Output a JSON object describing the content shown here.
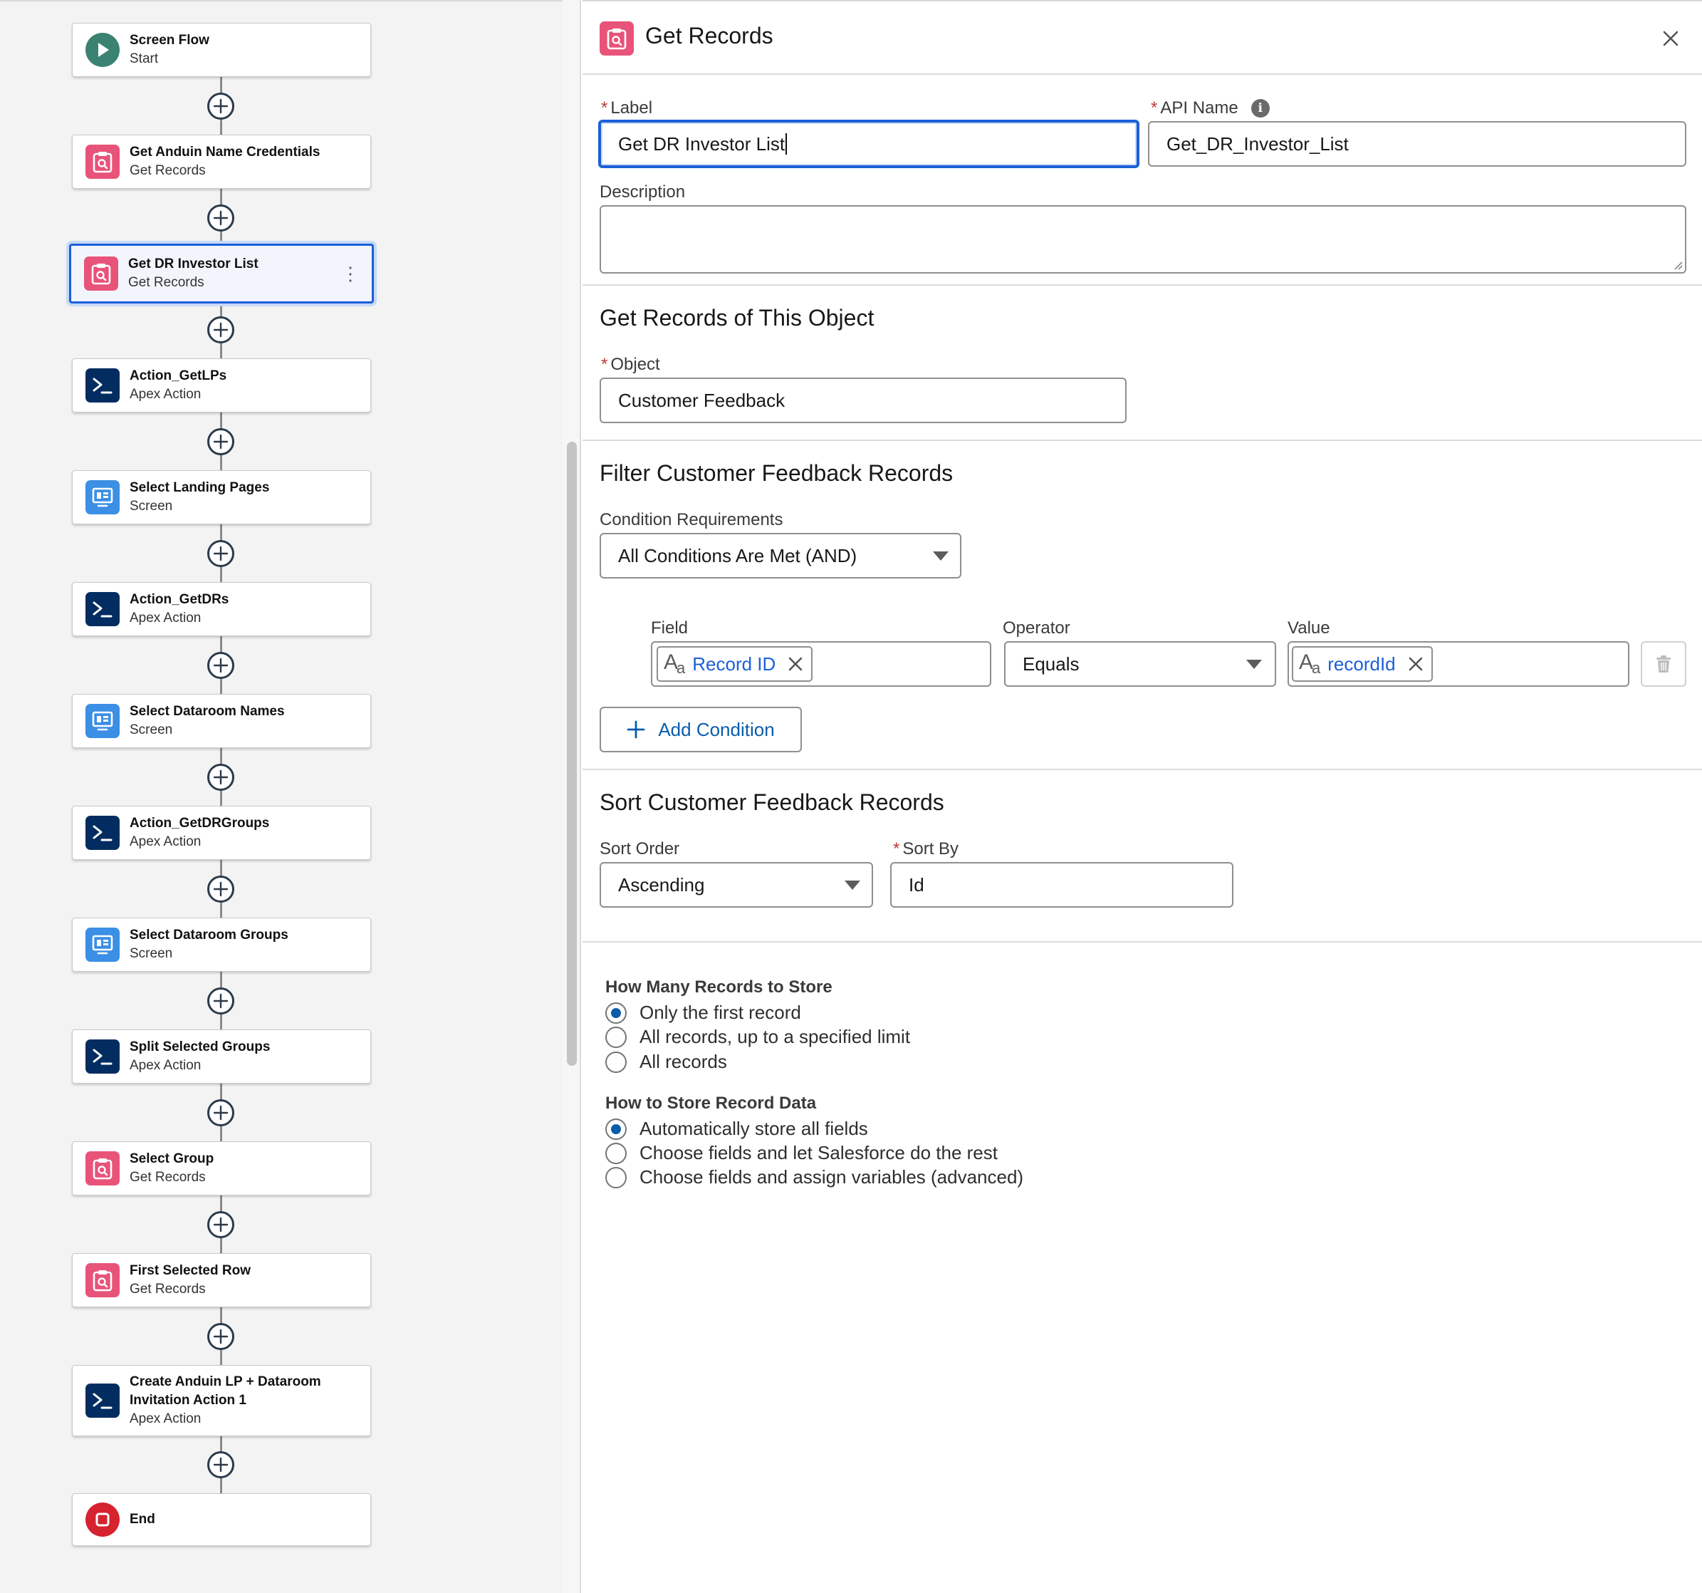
{
  "canvas": {
    "nodes": [
      {
        "title": "Screen Flow",
        "subtitle": "Start",
        "icon": "play-icon"
      },
      {
        "title": "Get Anduin Name Credentials",
        "subtitle": "Get Records",
        "icon": "get-records-icon"
      },
      {
        "title": "Get DR Investor List",
        "subtitle": "Get Records",
        "icon": "get-records-icon"
      },
      {
        "title": "Action_GetLPs",
        "subtitle": "Apex Action",
        "icon": "apex-action-icon"
      },
      {
        "title": "Select Landing Pages",
        "subtitle": "Screen",
        "icon": "screen-icon"
      },
      {
        "title": "Action_GetDRs",
        "subtitle": "Apex Action",
        "icon": "apex-action-icon"
      },
      {
        "title": "Select Dataroom Names",
        "subtitle": "Screen",
        "icon": "screen-icon"
      },
      {
        "title": "Action_GetDRGroups",
        "subtitle": "Apex Action",
        "icon": "apex-action-icon"
      },
      {
        "title": "Select Dataroom Groups",
        "subtitle": "Screen",
        "icon": "screen-icon"
      },
      {
        "title": "Split Selected Groups",
        "subtitle": "Apex Action",
        "icon": "apex-action-icon"
      },
      {
        "title": "Select Group",
        "subtitle": "Get Records",
        "icon": "get-records-icon"
      },
      {
        "title": "First Selected Row",
        "subtitle": "Get Records",
        "icon": "get-records-icon"
      },
      {
        "title": "Create Anduin LP + Dataroom Invitation Action 1",
        "subtitle": "Apex Action",
        "icon": "apex-action-icon"
      },
      {
        "title": "End",
        "subtitle": "",
        "icon": "stop-icon"
      }
    ],
    "selected_node": "Get DR Investor List"
  },
  "panel": {
    "header": {
      "title": "Get Records",
      "icon": "get-records-icon"
    },
    "label": {
      "label": "Label",
      "value": "Get DR Investor List"
    },
    "api_name": {
      "label": "API Name",
      "value": "Get_DR_Investor_List"
    },
    "description": {
      "label": "Description",
      "value": ""
    },
    "object_section": {
      "title": "Get Records of This Object",
      "object_label": "Object",
      "object_value": "Customer Feedback"
    },
    "filter_section": {
      "title": "Filter Customer Feedback Records",
      "condition_req_label": "Condition Requirements",
      "condition_req_value": "All Conditions Are Met (AND)",
      "field_header": "Field",
      "operator_header": "Operator",
      "value_header": "Value",
      "condition": {
        "field": "Record ID",
        "operator": "Equals",
        "value": "recordId"
      },
      "add_condition": "Add Condition"
    },
    "sort_section": {
      "title": "Sort Customer Feedback Records",
      "sort_order_label": "Sort Order",
      "sort_order_value": "Ascending",
      "sort_by_label": "Sort By",
      "sort_by_value": "Id"
    },
    "store_count": {
      "title": "How Many Records to Store",
      "options": [
        "Only the first record",
        "All records, up to a specified limit",
        "All records"
      ],
      "selected": 0
    },
    "store_data": {
      "title": "How to Store Record Data",
      "options": [
        "Automatically store all fields",
        "Choose fields and let Salesforce do the rest",
        "Choose fields and assign variables (advanced)"
      ],
      "selected": 0
    }
  },
  "colors": {
    "accent": "#1b5fd8",
    "link": "#0b5cab",
    "get_records": "#e8537a",
    "apex": "#032d60",
    "screen": "#3b8fe4",
    "start": "#3a8271",
    "end": "#d6232f"
  }
}
